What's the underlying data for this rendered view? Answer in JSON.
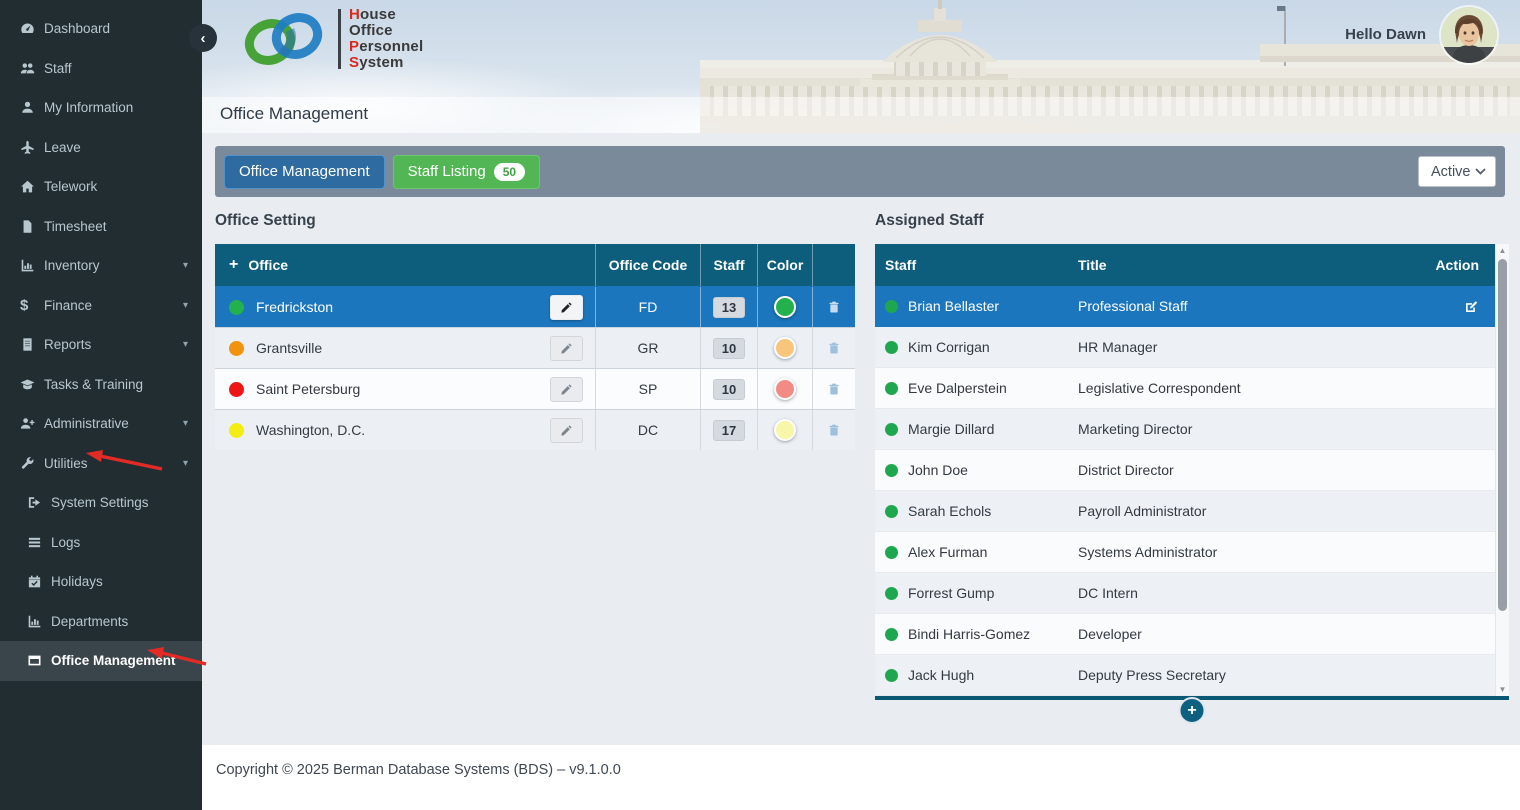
{
  "sidebar": {
    "items": [
      {
        "label": "Dashboard",
        "icon": "dashboard"
      },
      {
        "label": "Staff",
        "icon": "users"
      },
      {
        "label": "My Information",
        "icon": "user"
      },
      {
        "label": "Leave",
        "icon": "plane"
      },
      {
        "label": "Telework",
        "icon": "home"
      },
      {
        "label": "Timesheet",
        "icon": "file"
      },
      {
        "label": "Inventory",
        "icon": "bar-chart",
        "caret": true
      },
      {
        "label": "Finance",
        "icon": "dollar",
        "caret": true
      },
      {
        "label": "Reports",
        "icon": "report",
        "caret": true
      },
      {
        "label": "Tasks & Training",
        "icon": "graduation-cap"
      },
      {
        "label": "Administrative",
        "icon": "user-plus",
        "caret": true
      },
      {
        "label": "Utilities",
        "icon": "wrench",
        "caret": true
      },
      {
        "label": "System Settings",
        "icon": "sign-out",
        "sub": true
      },
      {
        "label": "Logs",
        "icon": "list",
        "sub": true
      },
      {
        "label": "Holidays",
        "icon": "calendar-check",
        "sub": true
      },
      {
        "label": "Departments",
        "icon": "bar-chart",
        "sub": true
      },
      {
        "label": "Office Management",
        "icon": "window",
        "sub": true,
        "active": true
      }
    ]
  },
  "logo": {
    "line1_initial": "H",
    "line1_rest": "ouse",
    "line2_initial": "O",
    "line2_rest": "ffice",
    "line3_initial": "P",
    "line3_rest": "ersonnel",
    "line4_initial": "S",
    "line4_rest": "ystem"
  },
  "header": {
    "greeting": "Hello Dawn",
    "page_title": "Office Management"
  },
  "toolbar": {
    "tab_office": "Office Management",
    "tab_staff": "Staff Listing",
    "staff_count": "50",
    "filter_value": "Active"
  },
  "office_setting": {
    "title": "Office Setting",
    "columns": {
      "office": "Office",
      "code": "Office Code",
      "staff": "Staff",
      "color": "Color"
    },
    "rows": [
      {
        "name": "Fredrickston",
        "code": "FD",
        "staff": "13",
        "dot": "#23b14d",
        "swatch": "#23b14d",
        "selected": true
      },
      {
        "name": "Grantsville",
        "code": "GR",
        "staff": "10",
        "dot": "#f2930d",
        "swatch": "#f8c57c",
        "selected": false
      },
      {
        "name": "Saint Petersburg",
        "code": "SP",
        "staff": "10",
        "dot": "#ee1515",
        "swatch": "#f28b84",
        "selected": false
      },
      {
        "name": "Washington, D.C.",
        "code": "DC",
        "staff": "17",
        "dot": "#f2ee13",
        "swatch": "#f8f7a9",
        "selected": false
      }
    ]
  },
  "assigned_staff": {
    "title": "Assigned Staff",
    "columns": {
      "staff": "Staff",
      "title": "Title",
      "action": "Action"
    },
    "dot_color": "#1fa750",
    "rows": [
      {
        "name": "Brian Bellaster",
        "title": "Professional Staff",
        "selected": true
      },
      {
        "name": "Kim Corrigan",
        "title": "HR Manager"
      },
      {
        "name": "Eve Dalperstein",
        "title": "Legislative Correspondent"
      },
      {
        "name": "Margie Dillard",
        "title": "Marketing Director"
      },
      {
        "name": "John Doe",
        "title": "District Director"
      },
      {
        "name": "Sarah Echols",
        "title": "Payroll Administrator"
      },
      {
        "name": "Alex Furman",
        "title": "Systems Administrator"
      },
      {
        "name": "Forrest Gump",
        "title": "DC Intern"
      },
      {
        "name": "Bindi Harris-Gomez",
        "title": "Developer"
      },
      {
        "name": "Jack Hugh",
        "title": "Deputy Press Secretary"
      }
    ]
  },
  "footer": {
    "copyright": "Copyright © 2025 Berman Database Systems (BDS) – v9.1.0.0"
  },
  "colors": {
    "sidebar_bg": "#222d32",
    "sidebar_active_bg": "#3a444b",
    "table_header_teal": "#0d5d7d",
    "selected_row_blue": "#1b76bd",
    "toolbar_bg": "#7b8a9a",
    "tab_blue": "#2d6ba0",
    "tab_green": "#53b654",
    "annotation_red": "#e22b25"
  }
}
